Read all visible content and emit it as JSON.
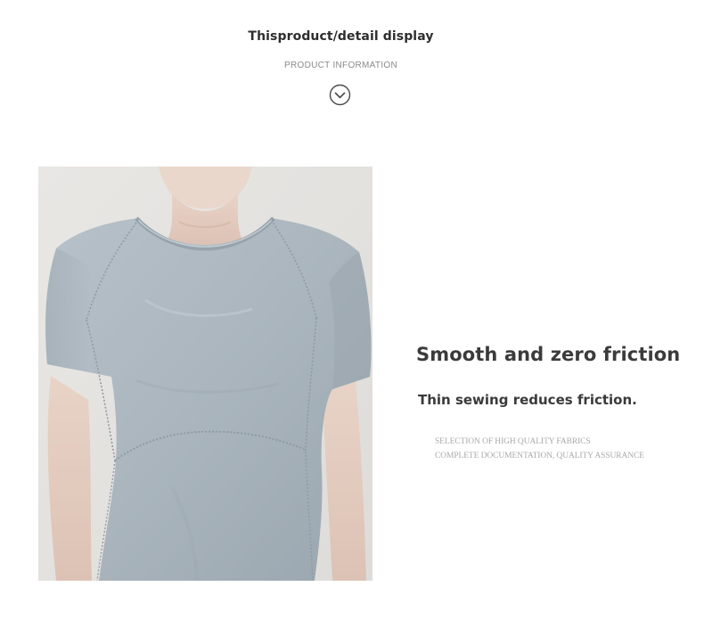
{
  "header": {
    "title": "Thisproduct/detail display",
    "subtitle": "PRODUCT INFORMATION",
    "scroll_icon": "chevron-down-circle-icon"
  },
  "product_image": {
    "subject": "light blue-grey short-sleeve athletic t-shirt worn by a model",
    "shirt_color": "#aab5bd",
    "background_color": "#e7e5e2"
  },
  "feature": {
    "heading": "Smooth and zero friction",
    "subheading": "Thin sewing reduces friction.",
    "notes": [
      "SELECTION OF HIGH QUALITY FABRICS",
      "COMPLETE DOCUMENTATION, QUALITY ASSURANCE"
    ]
  },
  "colors": {
    "heading_text": "#3b3b3b",
    "muted_text": "#a9a9a9"
  }
}
